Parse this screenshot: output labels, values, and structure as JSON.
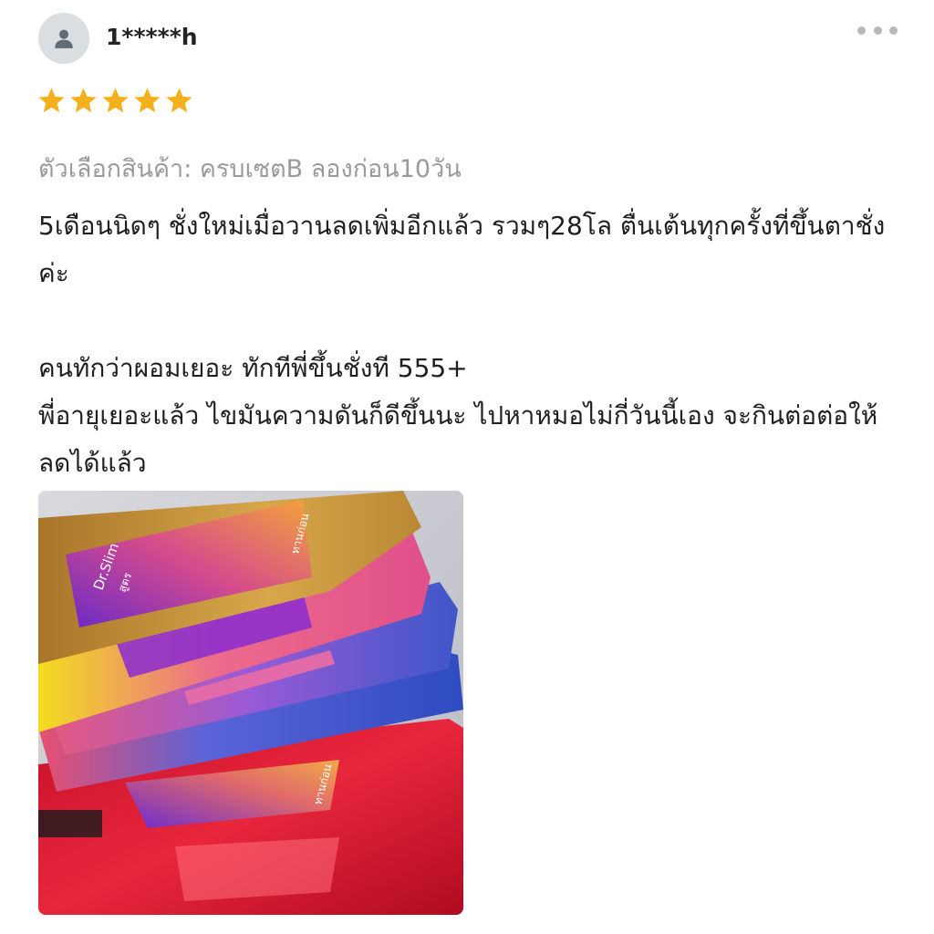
{
  "reviewer": {
    "name": "1*****h",
    "avatar_icon": "person-icon"
  },
  "menu_icon": "more-horizontal-icon",
  "rating": {
    "value": 5,
    "max": 5,
    "star_color": "#F5B01B"
  },
  "variant": "ตัวเลือกสินค้า: ครบเซตB ลองก่อน10วัน",
  "review_text": "5เดือนนิดๆ ชั่งใหม่เมื่อวานลดเพิ่มอีกแล้ว รวมๆ28โล ตื่นเต้นทุกครั้งที่ขึ้นตาชั่งค่ะ\n\nคนทักว่าผอมเยอะ ทักทีพี่ขึ้นชั่งที 555+\nพี่อายุเยอะแล้ว ไขมันความดันก็ดีขึ้นนะ ไปหาหมอไม่กี่วันนี้เอง จะกินต่อต่อให้ลดได้แล้ว",
  "photo": {
    "package_text": [
      "Dr.Slim",
      "สูตร",
      "ทานก่อน"
    ]
  }
}
